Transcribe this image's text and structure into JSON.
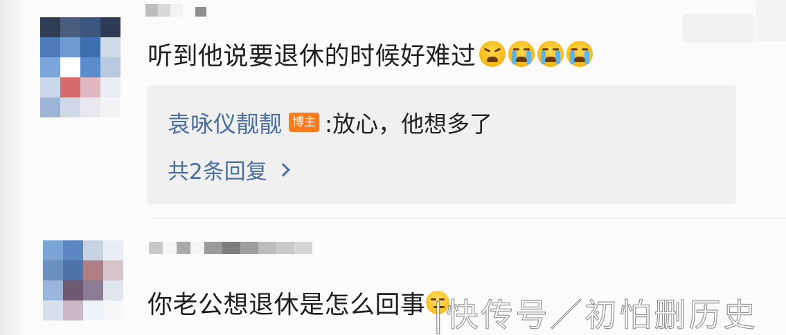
{
  "comments": [
    {
      "text": "听到他说要退休的时候好难过",
      "emojis": [
        "tired-face",
        "crying-face",
        "crying-face",
        "crying-face"
      ],
      "reply": {
        "author": "袁咏仪靓靓",
        "badge": "博主",
        "text": ":放心，他想多了",
        "count_label": "共2条回复"
      }
    },
    {
      "text": "你老公想退休是怎么回事",
      "emojis": [
        "thinking-face"
      ]
    }
  ],
  "watermark": "|快传号／初怕删历史",
  "colors": {
    "link": "#4a6e9e",
    "badge": "#ff7a1a",
    "reply_bg": "#f0f0f0",
    "text": "#1f1f1f"
  },
  "avatar1_colors": [
    "#2f3d52",
    "#4a5d80",
    "#3d5680",
    "#2e3b55",
    "#4e7cb8",
    "#6d99d1",
    "#3e6fb0",
    "#d0dbea",
    "#7aa6dc",
    "#ffffff",
    "#5b8ccc",
    "#b9c9e0",
    "#c9d8ea",
    "#d66a6a",
    "#e0b8c2",
    "#e9eef5",
    "#9fb5d8",
    "#cfd9e8",
    "#e8e8ec",
    "#f4f4f6"
  ],
  "avatar2_colors": [
    "#7aa3d6",
    "#5c87c0",
    "#c7d3e3",
    "#eaeef4",
    "#6b8fbf",
    "#4e73a8",
    "#b07f86",
    "#d6c3cc",
    "#9ab6dc",
    "#6e5a70",
    "#8c7c94",
    "#e2e6ee",
    "#d8e0ec",
    "#c8b9c4",
    "#eef1f5",
    "#f7f7f9"
  ]
}
